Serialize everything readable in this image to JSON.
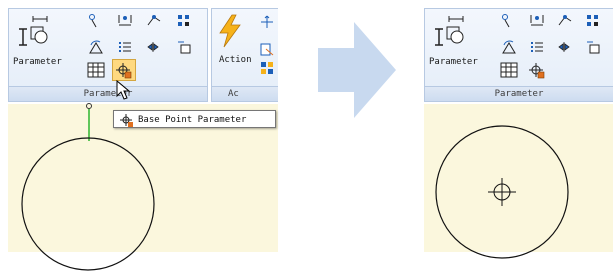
{
  "before": {
    "ribbon": {
      "parameter_button_label": "Parameter",
      "panel_title": "Parameter",
      "action_button_label": "Action",
      "action_panel_title_partial": "Ac"
    },
    "tooltip": {
      "text": "Base Point Parameter",
      "icon": "base-point-icon"
    }
  },
  "after": {
    "ribbon": {
      "parameter_button_label": "Parameter",
      "panel_title": "Parameter"
    }
  },
  "transition_arrow": {
    "color": "#c8d9ef"
  },
  "colors": {
    "canvas": "#fbf7dd",
    "ribbon": "#e4edf8",
    "selected_tool": "#ffd980",
    "grip_line": "#2db52d"
  }
}
